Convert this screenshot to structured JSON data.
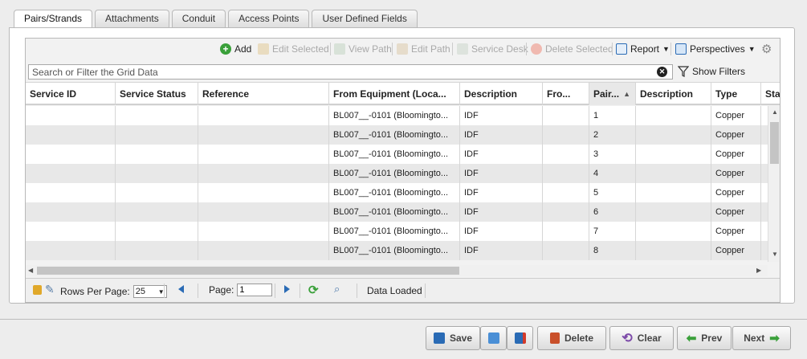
{
  "tabs": [
    {
      "label": "Pairs/Strands",
      "active": true
    },
    {
      "label": "Attachments"
    },
    {
      "label": "Conduit"
    },
    {
      "label": "Access Points"
    },
    {
      "label": "User Defined Fields"
    }
  ],
  "toolbar": {
    "add": "Add",
    "edit_selected": "Edit Selected",
    "view_path": "View Path",
    "edit_path": "Edit Path",
    "service_desk": "Service Desk",
    "delete_selected": "Delete Selected",
    "report": "Report",
    "perspectives": "Perspectives"
  },
  "search": {
    "placeholder": "Search or Filter the Grid Data",
    "show_filters": "Show Filters"
  },
  "columns": [
    "Service ID",
    "Service Status",
    "Reference",
    "From Equipment (Loca...",
    "Description",
    "Fro...",
    "Pair...",
    "Description",
    "Type",
    "Sta"
  ],
  "rows": [
    [
      "",
      "",
      "",
      "BL007__-0101 (Bloomingto...",
      "IDF",
      "",
      "1",
      "",
      "Copper",
      ""
    ],
    [
      "",
      "",
      "",
      "BL007__-0101 (Bloomingto...",
      "IDF",
      "",
      "2",
      "",
      "Copper",
      ""
    ],
    [
      "",
      "",
      "",
      "BL007__-0101 (Bloomingto...",
      "IDF",
      "",
      "3",
      "",
      "Copper",
      ""
    ],
    [
      "",
      "",
      "",
      "BL007__-0101 (Bloomingto...",
      "IDF",
      "",
      "4",
      "",
      "Copper",
      ""
    ],
    [
      "",
      "",
      "",
      "BL007__-0101 (Bloomingto...",
      "IDF",
      "",
      "5",
      "",
      "Copper",
      ""
    ],
    [
      "",
      "",
      "",
      "BL007__-0101 (Bloomingto...",
      "IDF",
      "",
      "6",
      "",
      "Copper",
      ""
    ],
    [
      "",
      "",
      "",
      "BL007__-0101 (Bloomingto...",
      "IDF",
      "",
      "7",
      "",
      "Copper",
      ""
    ],
    [
      "",
      "",
      "",
      "BL007__-0101 (Bloomingto...",
      "IDF",
      "",
      "8",
      "",
      "Copper",
      ""
    ]
  ],
  "pager": {
    "rows_per_page_label": "Rows Per Page:",
    "rows_per_page": "25",
    "page_label": "Page:",
    "page": "1",
    "status": "Data Loaded"
  },
  "buttons": {
    "save": "Save",
    "delete": "Delete",
    "clear": "Clear",
    "prev": "Prev",
    "next": "Next"
  },
  "colors": {
    "accent": "#2a6bb5",
    "add_green": "#3aa03a",
    "delete_orange": "#c9502a",
    "alt_row": "#e8e8e8"
  }
}
